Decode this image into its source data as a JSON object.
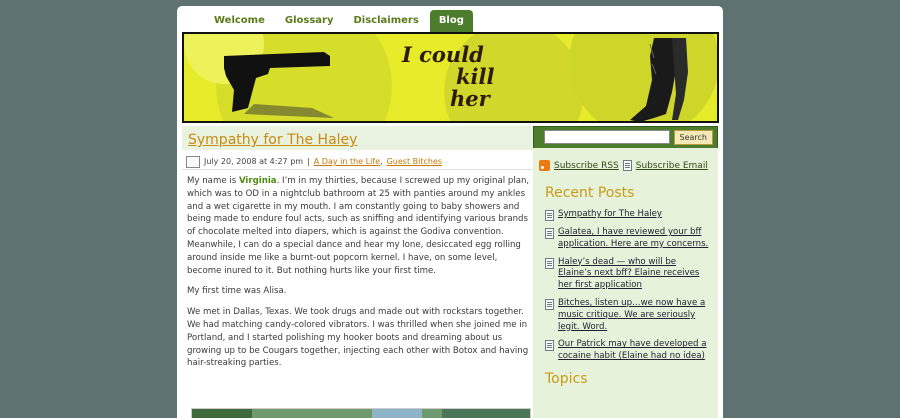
{
  "nav": {
    "tabs": [
      "Welcome",
      "Glossary",
      "Disclaimers",
      "Blog"
    ],
    "active": "Blog"
  },
  "header": {
    "line1": "I could",
    "line2": "kill",
    "line3": "her",
    "colors": {
      "bg": "#e7ec2a",
      "circle": "#d4db27",
      "text": "#2d1c05"
    }
  },
  "post": {
    "title": "Sympathy for The Haley",
    "date": "July 20, 2008 at 4:27 pm",
    "separator": "|",
    "category1": "A Day in the Life",
    "comma": ",",
    "category2": "Guest Bitches",
    "intro_prefix": "My name is",
    "author": "Virginia",
    "p1": ".  I’m in my thirties, because I screwed up my original plan, which was to OD in a nightclub bathroom at 25 with panties around my ankles and a wet cigarette in my mouth.  I am constantly going to baby showers and being made to endure foul acts, such as sniffing and identifying various brands of chocolate melted into diapers, which is against the Godiva convention. Meanwhile, I can do a special dance and hear my lone, desiccated egg rolling around inside me like a burnt-out popcorn kernel.  I have, on some level, become inured to it.  But nothing hurts like your first time.",
    "p2": "My first time was Alisa.",
    "p3": "We met in Dallas, Texas.  We took drugs and made out with rockstars together. We had matching candy-colored vibrators.  I was thrilled when she joined me in Portland, and I started polishing my hooker boots and dreaming about us growing up to be Cougars together, injecting each other with Botox and having hair-streaking parties."
  },
  "sidebar": {
    "search_placeholder": "",
    "search_button": "Search",
    "subscribe_rss": "Subscribe RSS",
    "subscribe_email": "Subscribe Email",
    "recent_heading": "Recent Posts",
    "recent": [
      "Sympathy for The Haley",
      "Galatea, I have reviewed your bff application. Here are my concerns.",
      "Haley’s dead — who will be Elaine’s next bff? Elaine receives her first application",
      "Bitches, listen up…we now have a music critique. We are seriously legit. Word.",
      "Our Patrick may have developed a cocaine habit (Elaine had no idea)"
    ],
    "topics_heading": "Topics"
  },
  "colors": {
    "background": "#5f7272",
    "accent_green": "#4d7d2c",
    "link_gold": "#c98a12"
  }
}
